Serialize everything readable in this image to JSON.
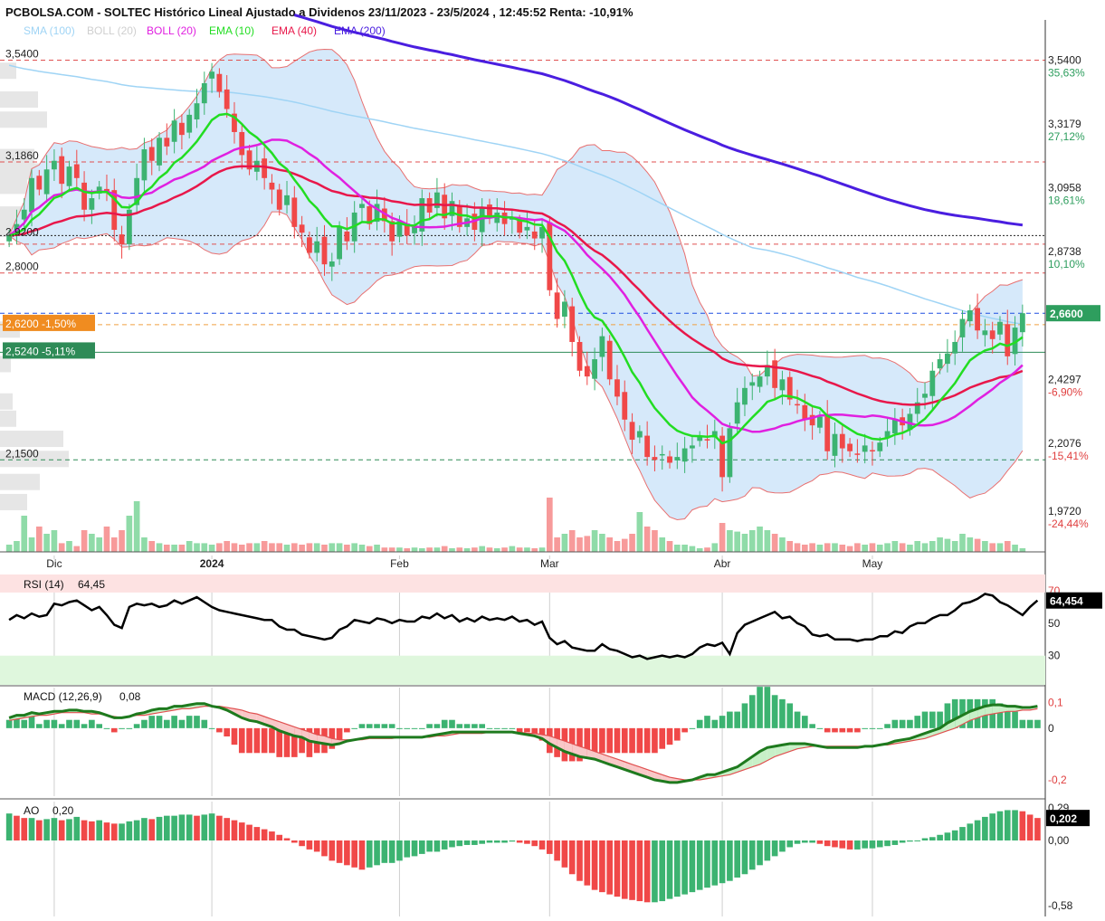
{
  "header": {
    "title": "PCBOLSA.COM - SOLTEC Histórico Lineal Ajustado a Dividenos 23/11/2023 - 23/5/2024 , 12:45:52 Renta: -10,91%"
  },
  "legend": [
    {
      "label": "SMA (100)",
      "color": "#9fd4f5"
    },
    {
      "label": "BOLL (20)",
      "color": "#cfcfcf"
    },
    {
      "label": "BOLL (20)",
      "color": "#e020e0"
    },
    {
      "label": "EMA (10)",
      "color": "#22dd22"
    },
    {
      "label": "EMA (40)",
      "color": "#e8174a"
    },
    {
      "label": "EMA (200)",
      "color": "#4a1ee0"
    }
  ],
  "colors": {
    "up": "#3cb371",
    "down": "#f04848",
    "up_vol": "#8fdba8",
    "down_vol": "#f79a9a",
    "ema10": "#22dd22",
    "ema40": "#e8174a",
    "ema200": "#4a1ee0",
    "boll_mid": "#e020e0",
    "sma100": "#9fd4f5",
    "boll_fill": "#d6e9fa",
    "boll_edge": "#e87070",
    "rsi": "#000000",
    "macd": "#1e7a1e",
    "signal": "#e05050",
    "accent_blue": "#1f4fe0"
  },
  "chart_data": [
    {
      "type": "candlestick",
      "name": "price",
      "xlabels": [
        {
          "label": "Dic",
          "index": 6
        },
        {
          "label": "2024",
          "index": 27
        },
        {
          "label": "Feb",
          "index": 52
        },
        {
          "label": "Mar",
          "index": 72
        },
        {
          "label": "Abr",
          "index": 95
        },
        {
          "label": "May",
          "index": 115
        }
      ],
      "ylim": [
        1.83,
        3.68
      ],
      "right_ticks": [
        {
          "value": 3.54,
          "label": "3,5400",
          "pct": "35,63%"
        },
        {
          "value": 3.3179,
          "label": "3,3179",
          "pct": "27,12%"
        },
        {
          "value": 3.0958,
          "label": "3,0958",
          "pct": "18,61%"
        },
        {
          "value": 2.8738,
          "label": "2,8738",
          "pct": "10,10%"
        },
        {
          "value": 2.4297,
          "label": "2,4297",
          "pct": "-6,90%"
        },
        {
          "value": 2.2076,
          "label": "2,2076",
          "pct": "-15,41%"
        },
        {
          "value": 1.972,
          "label": "1,9720",
          "pct": "-24,44%"
        }
      ],
      "left_levels": [
        {
          "value": 3.54,
          "label": "3,5400"
        },
        {
          "value": 3.186,
          "label": "3,1860"
        },
        {
          "value": 2.92,
          "label": "2,9200"
        },
        {
          "value": 2.8,
          "label": "2,8000"
        },
        {
          "value": 2.15,
          "label": "2,1500"
        }
      ],
      "hlines": [
        {
          "value": 3.54,
          "style": "dash",
          "color": "#e05050"
        },
        {
          "value": 3.186,
          "style": "dash",
          "color": "#e05050"
        },
        {
          "value": 2.93,
          "style": "dot",
          "color": "#222222"
        },
        {
          "value": 2.9,
          "style": "dash",
          "color": "#e05050"
        },
        {
          "value": 2.8,
          "style": "dash",
          "color": "#e05050"
        },
        {
          "value": 2.66,
          "style": "dash",
          "color": "#1f4fe0"
        },
        {
          "value": 2.62,
          "style": "dash",
          "color": "#f0a040"
        },
        {
          "value": 2.524,
          "style": "solid",
          "color": "#2e8b57"
        },
        {
          "value": 2.15,
          "style": "dash",
          "color": "#2e8b57"
        }
      ],
      "tags": {
        "last_price": "2,6600",
        "tag1": "2,6200 -1,50%",
        "tag2": "2,5240 -5,11%"
      },
      "closes": [
        2.93,
        2.97,
        3.02,
        3.13,
        3.09,
        3.16,
        3.19,
        3.11,
        3.17,
        3.13,
        3.02,
        3.06,
        3.1,
        3.08,
        2.95,
        2.9,
        3.02,
        3.13,
        3.23,
        3.19,
        3.27,
        3.24,
        3.33,
        3.28,
        3.35,
        3.39,
        3.46,
        3.5,
        3.43,
        3.37,
        3.29,
        3.21,
        3.16,
        3.19,
        3.13,
        3.09,
        3.02,
        3.07,
        2.96,
        2.94,
        2.87,
        2.91,
        2.83,
        2.84,
        2.96,
        2.91,
        3.01,
        3.04,
        2.97,
        3.04,
        2.98,
        2.91,
        2.98,
        2.93,
        2.96,
        3.06,
        3.01,
        3.08,
        2.99,
        3.05,
        2.96,
        2.99,
        2.95,
        3.03,
        2.99,
        3.01,
        2.97,
        2.99,
        2.94,
        2.96,
        2.92,
        2.96,
        2.74,
        2.64,
        2.7,
        2.56,
        2.46,
        2.44,
        2.5,
        2.58,
        2.43,
        2.37,
        2.29,
        2.22,
        2.25,
        2.16,
        2.15,
        2.17,
        2.14,
        2.16,
        2.19,
        2.2,
        2.23,
        2.22,
        2.25,
        2.09,
        2.26,
        2.35,
        2.4,
        2.42,
        2.44,
        2.48,
        2.4,
        2.43,
        2.36,
        2.34,
        2.29,
        2.27,
        2.3,
        2.18,
        2.24,
        2.19,
        2.18,
        2.17,
        2.2,
        2.18,
        2.21,
        2.25,
        2.29,
        2.27,
        2.31,
        2.35,
        2.38,
        2.46,
        2.5,
        2.52,
        2.56,
        2.64,
        2.67,
        2.6,
        2.6,
        2.57,
        2.63,
        2.51,
        2.61,
        2.66
      ],
      "volumes": [
        0.1,
        0.15,
        0.5,
        0.2,
        0.35,
        0.25,
        0.3,
        0.12,
        0.15,
        0.08,
        0.3,
        0.25,
        0.2,
        0.35,
        0.2,
        0.3,
        0.5,
        0.7,
        0.2,
        0.15,
        0.12,
        0.1,
        0.1,
        0.1,
        0.15,
        0.12,
        0.12,
        0.1,
        0.12,
        0.15,
        0.12,
        0.1,
        0.12,
        0.12,
        0.15,
        0.12,
        0.12,
        0.1,
        0.12,
        0.1,
        0.12,
        0.12,
        0.1,
        0.12,
        0.12,
        0.1,
        0.12,
        0.1,
        0.08,
        0.1,
        0.06,
        0.06,
        0.06,
        0.05,
        0.06,
        0.05,
        0.06,
        0.06,
        0.08,
        0.05,
        0.06,
        0.05,
        0.06,
        0.08,
        0.06,
        0.05,
        0.06,
        0.08,
        0.06,
        0.06,
        0.05,
        0.06,
        0.75,
        0.2,
        0.25,
        0.3,
        0.2,
        0.22,
        0.3,
        0.25,
        0.2,
        0.15,
        0.18,
        0.25,
        0.55,
        0.35,
        0.3,
        0.2,
        0.15,
        0.1,
        0.1,
        0.08,
        0.05,
        0.06,
        0.12,
        0.4,
        0.3,
        0.28,
        0.25,
        0.3,
        0.35,
        0.3,
        0.25,
        0.2,
        0.15,
        0.12,
        0.1,
        0.12,
        0.1,
        0.12,
        0.12,
        0.1,
        0.08,
        0.12,
        0.1,
        0.12,
        0.1,
        0.12,
        0.15,
        0.12,
        0.1,
        0.15,
        0.12,
        0.15,
        0.2,
        0.18,
        0.15,
        0.25,
        0.2,
        0.18,
        0.15,
        0.12,
        0.12,
        0.15,
        0.1,
        0.05
      ]
    },
    {
      "type": "line",
      "name": "RSI",
      "label": "RSI (14)",
      "value_text": "64,45",
      "last_tag": "64,454",
      "levels": [
        {
          "value": 70,
          "label": "70"
        },
        {
          "value": 50,
          "label": "50"
        },
        {
          "value": 30,
          "label": "30"
        }
      ],
      "ylim": [
        12,
        80
      ],
      "values": [
        52,
        55,
        53,
        56,
        54,
        55,
        62,
        61,
        63,
        64,
        61,
        58,
        60,
        55,
        49,
        47,
        60,
        62,
        61,
        62,
        60,
        61,
        64,
        62,
        64,
        66,
        63,
        60,
        58,
        57,
        56,
        55,
        54,
        53,
        52,
        52,
        48,
        46,
        46,
        43,
        42,
        41,
        40,
        41,
        46,
        48,
        52,
        51,
        50,
        53,
        52,
        50,
        52,
        51,
        51,
        54,
        53,
        56,
        53,
        55,
        51,
        53,
        51,
        54,
        52,
        53,
        52,
        54,
        51,
        52,
        49,
        51,
        41,
        37,
        39,
        35,
        34,
        33,
        33,
        37,
        34,
        33,
        31,
        29,
        30,
        28,
        29,
        30,
        29,
        30,
        29,
        31,
        35,
        37,
        36,
        38,
        31,
        44,
        49,
        51,
        53,
        55,
        57,
        53,
        54,
        50,
        48,
        43,
        42,
        43,
        40,
        40,
        40,
        39,
        40,
        40,
        42,
        42,
        45,
        44,
        48,
        50,
        50,
        53,
        55,
        55,
        58,
        62,
        63,
        65,
        68,
        67,
        63,
        61,
        58,
        55,
        60,
        64
      ]
    },
    {
      "type": "line",
      "name": "MACD",
      "label": "MACD (12,26,9)",
      "value_text": "0,08",
      "ticks": [
        {
          "value": 0.1,
          "label": "0,1"
        },
        {
          "value": 0,
          "label": "0"
        },
        {
          "value": -0.2,
          "label": "-0,2"
        }
      ],
      "ylim": [
        -0.27,
        0.15
      ],
      "macd": [
        0.04,
        0.05,
        0.05,
        0.06,
        0.055,
        0.06,
        0.065,
        0.065,
        0.07,
        0.07,
        0.065,
        0.065,
        0.06,
        0.05,
        0.04,
        0.04,
        0.045,
        0.055,
        0.06,
        0.07,
        0.075,
        0.075,
        0.085,
        0.085,
        0.09,
        0.095,
        0.095,
        0.085,
        0.08,
        0.07,
        0.055,
        0.04,
        0.03,
        0.025,
        0.015,
        0.005,
        -0.01,
        -0.02,
        -0.03,
        -0.035,
        -0.05,
        -0.055,
        -0.06,
        -0.065,
        -0.06,
        -0.05,
        -0.045,
        -0.04,
        -0.035,
        -0.035,
        -0.035,
        -0.035,
        -0.035,
        -0.035,
        -0.035,
        -0.035,
        -0.03,
        -0.025,
        -0.02,
        -0.015,
        -0.015,
        -0.015,
        -0.015,
        -0.015,
        -0.015,
        -0.015,
        -0.015,
        -0.015,
        -0.02,
        -0.025,
        -0.03,
        -0.04,
        -0.06,
        -0.075,
        -0.09,
        -0.1,
        -0.11,
        -0.115,
        -0.12,
        -0.13,
        -0.14,
        -0.15,
        -0.16,
        -0.17,
        -0.18,
        -0.19,
        -0.2,
        -0.205,
        -0.21,
        -0.21,
        -0.205,
        -0.2,
        -0.19,
        -0.18,
        -0.18,
        -0.17,
        -0.16,
        -0.15,
        -0.13,
        -0.11,
        -0.09,
        -0.075,
        -0.07,
        -0.065,
        -0.06,
        -0.06,
        -0.06,
        -0.065,
        -0.07,
        -0.075,
        -0.075,
        -0.075,
        -0.075,
        -0.075,
        -0.07,
        -0.07,
        -0.065,
        -0.06,
        -0.05,
        -0.045,
        -0.04,
        -0.03,
        -0.02,
        -0.01,
        0.0,
        0.02,
        0.035,
        0.05,
        0.065,
        0.075,
        0.085,
        0.09,
        0.09,
        0.085,
        0.085,
        0.08,
        0.08,
        0.085
      ],
      "signal": [
        0.03,
        0.035,
        0.04,
        0.045,
        0.05,
        0.05,
        0.055,
        0.06,
        0.06,
        0.06,
        0.06,
        0.055,
        0.055,
        0.05,
        0.045,
        0.04,
        0.045,
        0.05,
        0.05,
        0.055,
        0.06,
        0.065,
        0.07,
        0.075,
        0.075,
        0.08,
        0.085,
        0.085,
        0.085,
        0.08,
        0.075,
        0.07,
        0.06,
        0.055,
        0.045,
        0.035,
        0.025,
        0.015,
        0.005,
        -0.005,
        -0.015,
        -0.025,
        -0.03,
        -0.04,
        -0.045,
        -0.045,
        -0.045,
        -0.045,
        -0.04,
        -0.04,
        -0.04,
        -0.04,
        -0.035,
        -0.035,
        -0.035,
        -0.035,
        -0.035,
        -0.03,
        -0.03,
        -0.025,
        -0.02,
        -0.02,
        -0.02,
        -0.02,
        -0.015,
        -0.015,
        -0.015,
        -0.015,
        -0.015,
        -0.02,
        -0.02,
        -0.025,
        -0.03,
        -0.04,
        -0.05,
        -0.06,
        -0.07,
        -0.08,
        -0.09,
        -0.1,
        -0.11,
        -0.12,
        -0.13,
        -0.14,
        -0.15,
        -0.16,
        -0.17,
        -0.18,
        -0.19,
        -0.195,
        -0.2,
        -0.2,
        -0.2,
        -0.195,
        -0.19,
        -0.185,
        -0.18,
        -0.17,
        -0.16,
        -0.15,
        -0.14,
        -0.125,
        -0.11,
        -0.1,
        -0.09,
        -0.08,
        -0.075,
        -0.07,
        -0.07,
        -0.07,
        -0.07,
        -0.07,
        -0.07,
        -0.07,
        -0.07,
        -0.07,
        -0.065,
        -0.065,
        -0.06,
        -0.055,
        -0.05,
        -0.045,
        -0.04,
        -0.03,
        -0.02,
        -0.01,
        0.0,
        0.015,
        0.03,
        0.04,
        0.05,
        0.055,
        0.06,
        0.065,
        0.065,
        0.07,
        0.07,
        0.075
      ]
    },
    {
      "type": "bar",
      "name": "AO",
      "label": "AO",
      "value_text": "0,20",
      "last_tag": "0,202",
      "ticks": [
        {
          "value": 0.29,
          "label": "0,29"
        },
        {
          "value": 0,
          "label": "0,00"
        },
        {
          "value": -0.58,
          "label": "-0,58"
        }
      ],
      "ylim": [
        -0.62,
        0.33
      ],
      "values": [
        0.24,
        0.22,
        0.2,
        0.2,
        0.18,
        0.19,
        0.2,
        0.18,
        0.19,
        0.21,
        0.18,
        0.17,
        0.18,
        0.16,
        0.15,
        0.15,
        0.17,
        0.18,
        0.2,
        0.19,
        0.21,
        0.22,
        0.22,
        0.23,
        0.23,
        0.22,
        0.23,
        0.24,
        0.22,
        0.2,
        0.18,
        0.16,
        0.14,
        0.12,
        0.1,
        0.08,
        0.05,
        0.02,
        -0.02,
        -0.05,
        -0.08,
        -0.1,
        -0.14,
        -0.18,
        -0.2,
        -0.22,
        -0.24,
        -0.26,
        -0.24,
        -0.22,
        -0.2,
        -0.2,
        -0.18,
        -0.15,
        -0.14,
        -0.12,
        -0.1,
        -0.1,
        -0.08,
        -0.06,
        -0.05,
        -0.04,
        -0.04,
        -0.03,
        -0.02,
        -0.02,
        -0.02,
        -0.01,
        -0.02,
        -0.03,
        -0.05,
        -0.08,
        -0.12,
        -0.18,
        -0.24,
        -0.3,
        -0.36,
        -0.4,
        -0.44,
        -0.46,
        -0.48,
        -0.5,
        -0.52,
        -0.53,
        -0.54,
        -0.55,
        -0.55,
        -0.54,
        -0.52,
        -0.5,
        -0.48,
        -0.46,
        -0.44,
        -0.42,
        -0.4,
        -0.38,
        -0.36,
        -0.33,
        -0.3,
        -0.26,
        -0.22,
        -0.18,
        -0.14,
        -0.1,
        -0.06,
        -0.03,
        -0.02,
        -0.02,
        -0.03,
        -0.05,
        -0.06,
        -0.07,
        -0.08,
        -0.08,
        -0.07,
        -0.07,
        -0.06,
        -0.05,
        -0.04,
        -0.02,
        -0.01,
        0.0,
        0.02,
        0.03,
        0.05,
        0.07,
        0.09,
        0.12,
        0.15,
        0.18,
        0.21,
        0.24,
        0.26,
        0.27,
        0.27,
        0.26,
        0.23,
        0.2
      ]
    }
  ]
}
